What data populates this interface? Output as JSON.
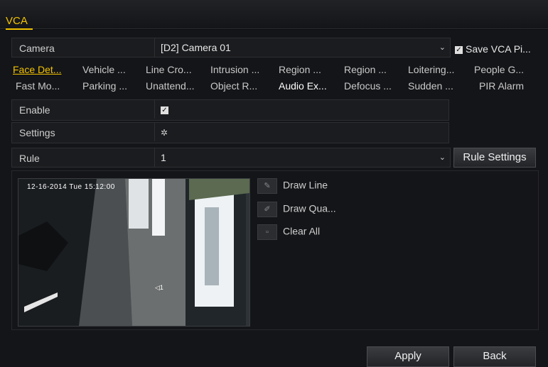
{
  "window": {
    "tab": "VCA"
  },
  "camera": {
    "label": "Camera",
    "value": "[D2] Camera 01",
    "save_label": "Save VCA Pi...",
    "save_checked": true
  },
  "vca_types_row1": [
    "Face Det...",
    "Vehicle ...",
    "Line Cro...",
    "Intrusion ...",
    "Region ...",
    "Region ...",
    "Loitering...",
    "People G..."
  ],
  "vca_types_row2": [
    "Fast Mo...",
    "Parking ...",
    "Unattend...",
    "Object R...",
    "Audio Ex...",
    "Defocus ...",
    "Sudden ...",
    "PIR Alarm"
  ],
  "enable": {
    "label": "Enable",
    "checked": true
  },
  "settings": {
    "label": "Settings",
    "icon": "gear-icon"
  },
  "rule": {
    "label": "Rule",
    "value": "1",
    "button": "Rule Settings"
  },
  "video": {
    "timestamp": "12-16-2014 Tue 15:12:00",
    "channel": "◁1"
  },
  "tools": {
    "draw_line": "Draw Line",
    "draw_quad": "Draw Qua...",
    "clear_all": "Clear All"
  },
  "footer": {
    "apply": "Apply",
    "back": "Back"
  },
  "colors": {
    "accent": "#f2c200",
    "background": "#141518"
  }
}
